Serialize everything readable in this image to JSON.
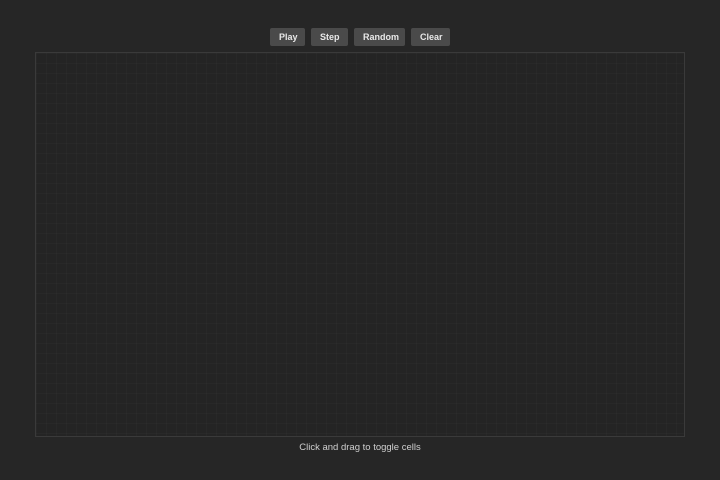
{
  "toolbar": {
    "play_label": "Play",
    "step_label": "Step",
    "random_label": "Random",
    "clear_label": "Clear"
  },
  "grid": {
    "cell_color": "#242424",
    "border_color": "#3a3a3a"
  },
  "footer": {
    "hint": "Click and drag to toggle cells"
  },
  "theme": {
    "background": "#262626",
    "button_bg": "#4a4a4a",
    "button_text": "#e8e8e8"
  }
}
